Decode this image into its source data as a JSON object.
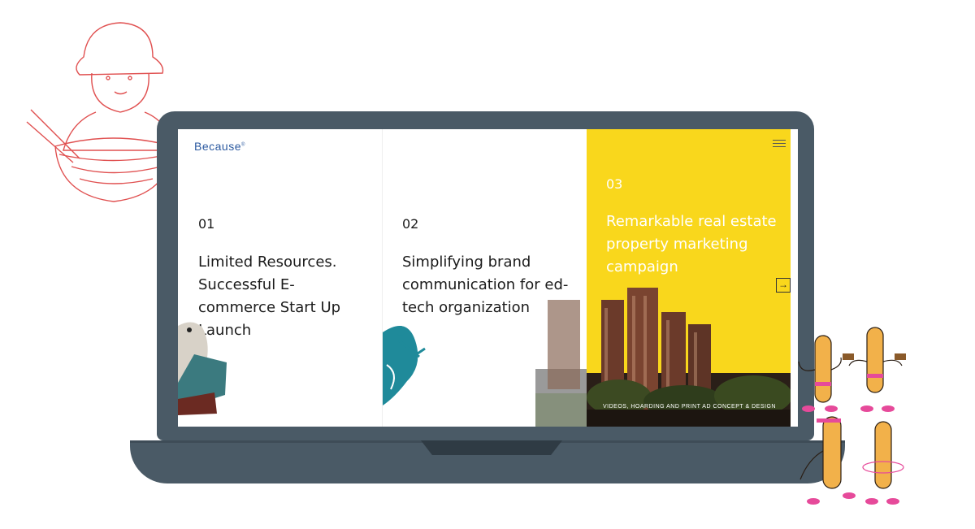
{
  "colors": {
    "laptop": "#4a5a66",
    "accent_yellow": "#f9d71c",
    "logo_blue": "#2c5aa0",
    "bowl_red": "#e05050"
  },
  "site": {
    "logo": "Because",
    "logo_mark": "®"
  },
  "menu_icon": "hamburger-menu-icon",
  "panels": [
    {
      "number": "01",
      "title": "Limited Resources.\nSuccessful E-\ncommerce Start Up\nLaunch",
      "image": "dog-on-chair"
    },
    {
      "number": "02",
      "title": "Simplifying brand\ncommunication for ed-\ntech organization",
      "image": "teal-figure-illustration"
    },
    {
      "number": "03",
      "title": "Remarkable real estate\nproperty marketing\ncampaign",
      "caption": "VIDEOS, HOARDING AND PRINT AD CONCEPT & DESIGN",
      "image": "apartment-towers"
    }
  ],
  "arrow_icon": "arrow-right-icon"
}
